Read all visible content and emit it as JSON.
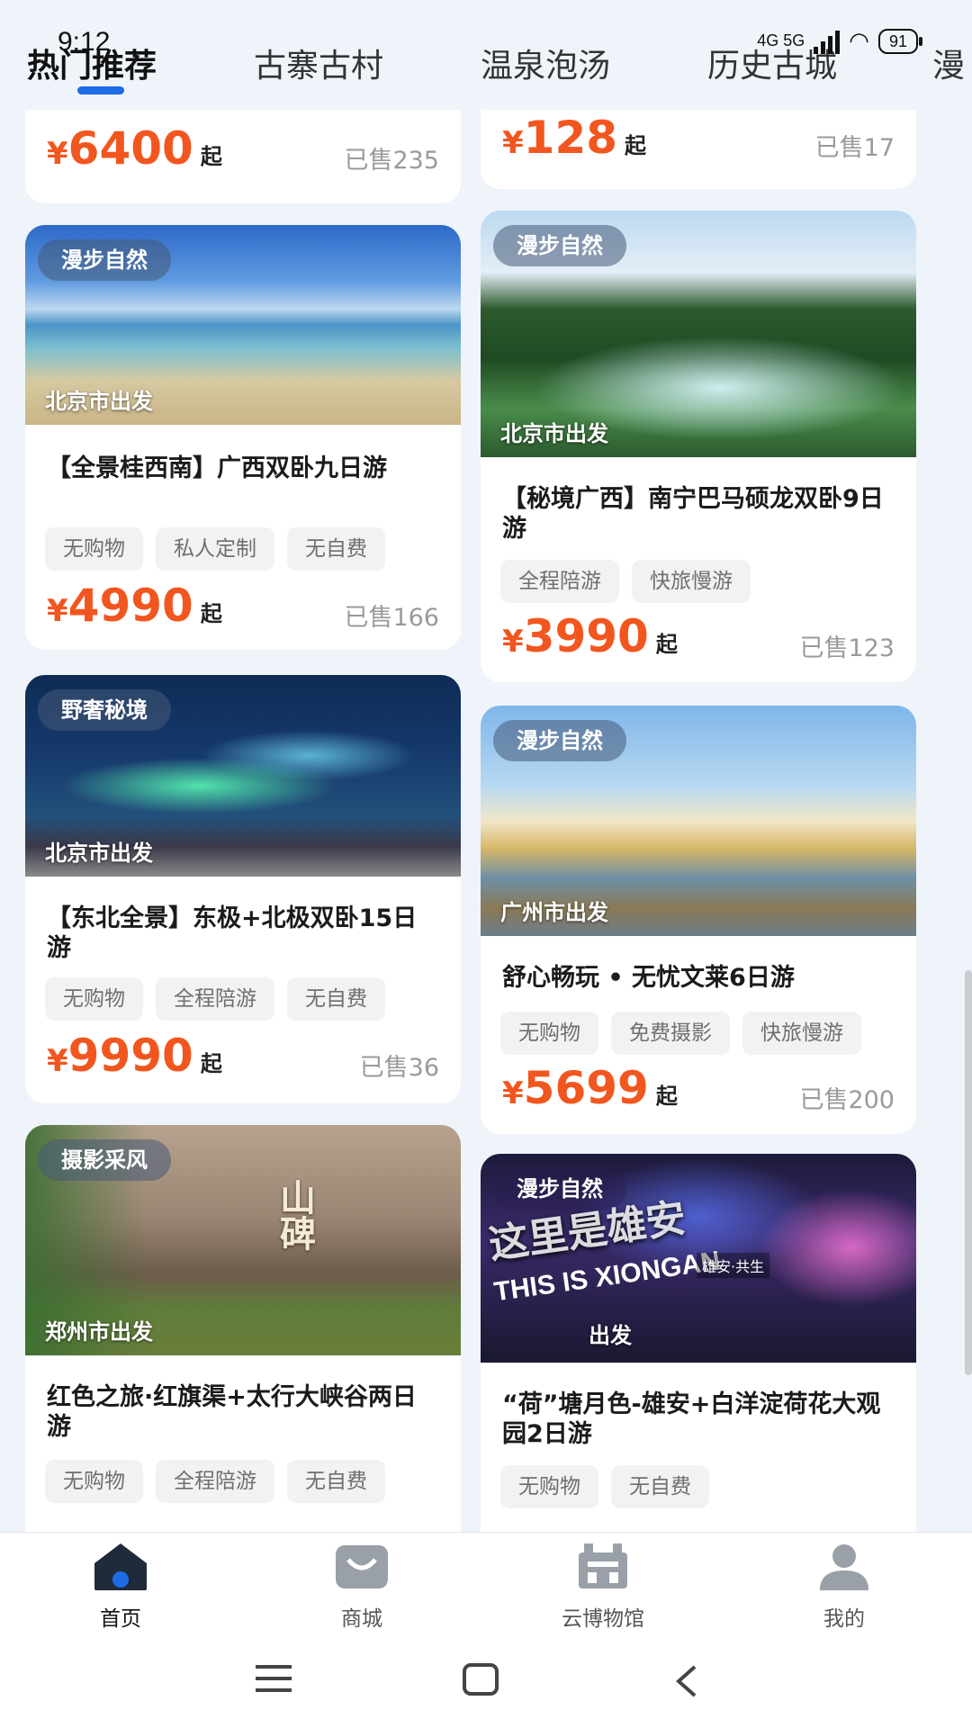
{
  "status_bar": {
    "time": "9:12",
    "network": "4G 5G",
    "battery": "91"
  },
  "tabs": [
    {
      "label": "热门推荐",
      "active": true
    },
    {
      "label": "古寨古村"
    },
    {
      "label": "温泉泡汤"
    },
    {
      "label": "历史古城"
    },
    {
      "label": "漫"
    }
  ],
  "cards": [
    {
      "price_currency": "¥",
      "price": "6400",
      "price_suffix": "起",
      "sold": "已售235"
    },
    {
      "price_currency": "¥",
      "price": "128",
      "price_suffix": "起",
      "sold": "已售17"
    },
    {
      "badge": "漫步自然",
      "origin": "北京市出发",
      "title": "【全景桂西南】广西双卧九日游",
      "tags": [
        "无购物",
        "私人定制",
        "无自费"
      ],
      "price_currency": "¥",
      "price": "4990",
      "price_suffix": "起",
      "sold": "已售166"
    },
    {
      "badge": "漫步自然",
      "origin": "北京市出发",
      "title": "【秘境广西】南宁巴马硕龙双卧9日游",
      "tags": [
        "全程陪游",
        "快旅慢游"
      ],
      "price_currency": "¥",
      "price": "3990",
      "price_suffix": "起",
      "sold": "已售123"
    },
    {
      "badge": "野奢秘境",
      "origin": "北京市出发",
      "title": "【东北全景】东极+北极双卧15日游",
      "tags": [
        "无购物",
        "全程陪游",
        "无自费"
      ],
      "price_currency": "¥",
      "price": "9990",
      "price_suffix": "起",
      "sold": "已售36"
    },
    {
      "badge": "漫步自然",
      "origin": "广州市出发",
      "title": "舒心畅玩 • 无忧文莱6日游",
      "tags": [
        "无购物",
        "免费摄影",
        "快旅慢游"
      ],
      "price_currency": "¥",
      "price": "5699",
      "price_suffix": "起",
      "sold": "已售200"
    },
    {
      "badge": "摄影采风",
      "origin": "郑州市出发",
      "title": "红色之旅·红旗渠+太行大峡谷两日游",
      "tags": [
        "无购物",
        "全程陪游",
        "无自费"
      ],
      "image_text": "山碑"
    },
    {
      "badge": "漫步自然",
      "origin": "出发",
      "title": "“荷”塘月色-雄安+白洋淀荷花大观园2日游",
      "tags": [
        "无购物",
        "无自费"
      ],
      "image_text": "这里是雄安",
      "image_text_en": "THIS IS XIONGAN",
      "image_text_sign": "雄安·共生"
    }
  ],
  "bottom_nav": [
    {
      "label": "首页",
      "icon": "home-icon",
      "active": true
    },
    {
      "label": "商城",
      "icon": "shopping-bag-icon"
    },
    {
      "label": "云博物馆",
      "icon": "museum-icon"
    },
    {
      "label": "我的",
      "icon": "user-icon"
    }
  ],
  "colors": {
    "price": "#f2561f",
    "accent": "#1e6be6",
    "background": "#eef4fa"
  }
}
